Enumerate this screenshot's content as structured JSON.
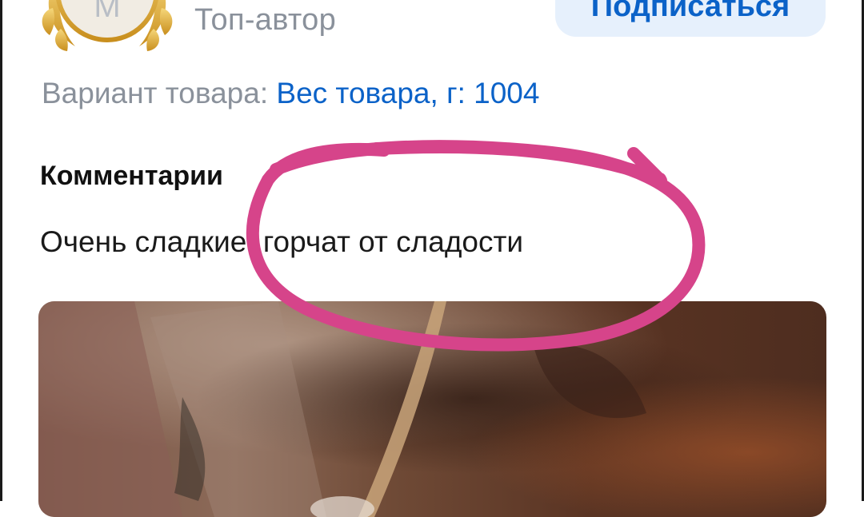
{
  "author": {
    "avatar_letter": "М",
    "status": "Топ-автор"
  },
  "actions": {
    "subscribe_label": "Подписаться"
  },
  "variant": {
    "label": "Вариант товара: ",
    "value": "Вес товара, г: 1004"
  },
  "comments": {
    "title": "Комментарии",
    "text": "Очень сладкие, горчат от сладости"
  },
  "colors": {
    "accent": "#0b62c8",
    "button_bg": "#e6f0fc",
    "muted_text": "#8a919b",
    "annotation": "#d6448a",
    "laurel": "#e3b23c"
  },
  "icons": {
    "badge": "laurel-wreath-icon",
    "markup": "hand-drawn-circle-annotation"
  }
}
